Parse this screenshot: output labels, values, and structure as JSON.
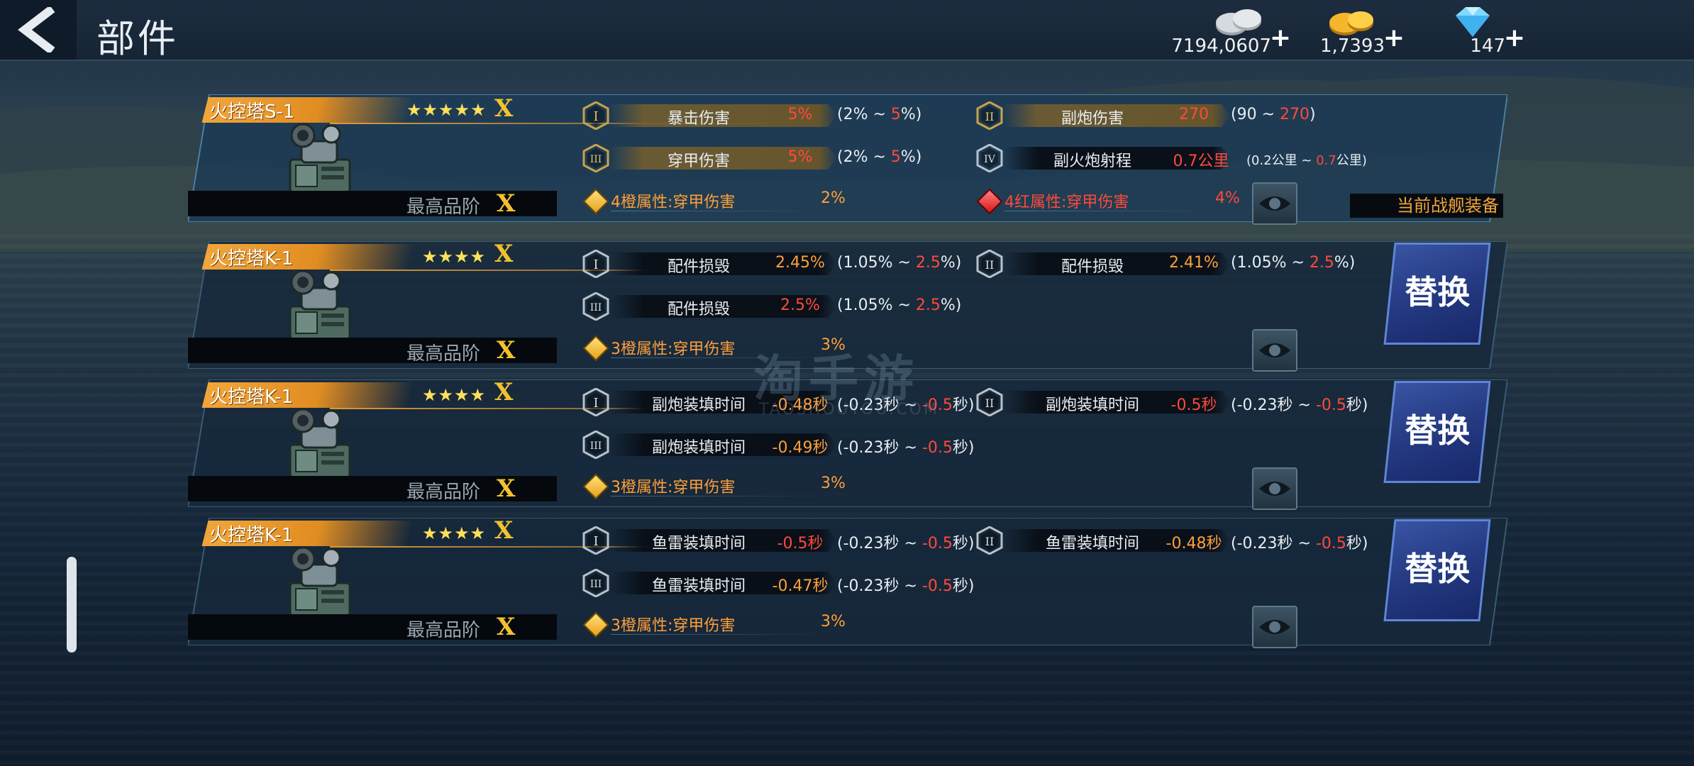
{
  "header": {
    "title": "部件"
  },
  "currencies": [
    {
      "name": "silver",
      "value": "7194,0607",
      "plus": "+",
      "icon": "silver-coins-icon",
      "color": "#c9cdd2"
    },
    {
      "name": "gold",
      "value": "1,7393",
      "plus": "+",
      "icon": "gold-coins-icon",
      "color": "#f4b62c"
    },
    {
      "name": "diamond",
      "value": "147",
      "plus": "+",
      "icon": "diamond-icon",
      "color": "#7fd8ff"
    }
  ],
  "panels": [
    {
      "name": "火控塔S-1",
      "stars": "★★★★★",
      "rank": "X",
      "max_label": "最高品阶",
      "rank_bottom": "X",
      "stats": [
        {
          "roman": "I",
          "name": "暴击伤害",
          "value": "5%",
          "range_pre": "(2% ~ ",
          "range_max": "5",
          "range_post": "%)"
        },
        {
          "roman": "II",
          "name": "副炮伤害",
          "value": "270",
          "range_pre": "(90 ~ ",
          "range_max": "270",
          "range_post": ")"
        },
        {
          "roman": "III",
          "name": "穿甲伤害",
          "value": "5%",
          "range_pre": "(2% ~ ",
          "range_max": "5",
          "range_post": "%)"
        },
        {
          "roman": "IV",
          "name": "副火炮射程",
          "value": "0.7公里",
          "range_pre": "(0.2公里 ~ ",
          "range_max": "0.7",
          "range_post": "公里)"
        }
      ],
      "sets": [
        {
          "text": "4橙属性:穿甲伤害",
          "pct": "2%"
        },
        {
          "text": "4红属性:穿甲伤害",
          "pct": "4%"
        }
      ],
      "equipped_label": "当前战舰装备"
    },
    {
      "name": "火控塔K-1",
      "stars": "★★★★",
      "rank": "X",
      "max_label": "最高品阶",
      "rank_bottom": "X",
      "stats": [
        {
          "roman": "I",
          "name": "配件损毁",
          "value": "2.45%",
          "range_pre": "(1.05% ~ ",
          "range_max": "2.5",
          "range_post": "%)"
        },
        {
          "roman": "II",
          "name": "配件损毁",
          "value": "2.41%",
          "range_pre": "(1.05% ~ ",
          "range_max": "2.5",
          "range_post": "%)"
        },
        {
          "roman": "III",
          "name": "配件损毁",
          "value": "2.5%",
          "range_pre": "(1.05% ~ ",
          "range_max": "2.5",
          "range_post": "%)"
        }
      ],
      "sets": [
        {
          "text": "3橙属性:穿甲伤害",
          "pct": "3%"
        }
      ],
      "replace_label": "替换"
    },
    {
      "name": "火控塔K-1",
      "stars": "★★★★",
      "rank": "X",
      "max_label": "最高品阶",
      "rank_bottom": "X",
      "stats": [
        {
          "roman": "I",
          "name": "副炮装填时间",
          "value": "-0.48秒",
          "range_pre": "(-0.23秒 ~ ",
          "range_max": "-0.5",
          "range_post": "秒)"
        },
        {
          "roman": "II",
          "name": "副炮装填时间",
          "value": "-0.5秒",
          "range_pre": "(-0.23秒 ~ ",
          "range_max": "-0.5",
          "range_post": "秒)"
        },
        {
          "roman": "III",
          "name": "副炮装填时间",
          "value": "-0.49秒",
          "range_pre": "(-0.23秒 ~ ",
          "range_max": "-0.5",
          "range_post": "秒)"
        }
      ],
      "sets": [
        {
          "text": "3橙属性:穿甲伤害",
          "pct": "3%"
        }
      ],
      "replace_label": "替换"
    },
    {
      "name": "火控塔K-1",
      "stars": "★★★★",
      "rank": "X",
      "max_label": "最高品阶",
      "rank_bottom": "X",
      "stats": [
        {
          "roman": "I",
          "name": "鱼雷装填时间",
          "value": "-0.5秒",
          "range_pre": "(-0.23秒 ~ ",
          "range_max": "-0.5",
          "range_post": "秒)"
        },
        {
          "roman": "II",
          "name": "鱼雷装填时间",
          "value": "-0.48秒",
          "range_pre": "(-0.23秒 ~ ",
          "range_max": "-0.5",
          "range_post": "秒)"
        },
        {
          "roman": "III",
          "name": "鱼雷装填时间",
          "value": "-0.47秒",
          "range_pre": "(-0.23秒 ~ ",
          "range_max": "-0.5",
          "range_post": "秒)"
        }
      ],
      "sets": [
        {
          "text": "3橙属性:穿甲伤害",
          "pct": "3%"
        }
      ],
      "replace_label": "替换"
    }
  ],
  "watermark": {
    "text": "淘手游",
    "sub": "TAOSHOUYOU.COM"
  }
}
